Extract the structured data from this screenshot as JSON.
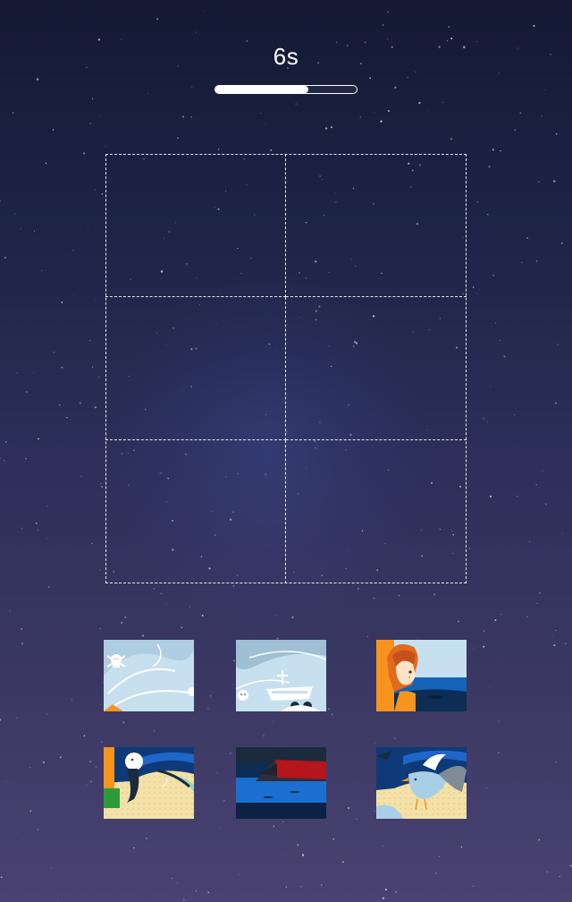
{
  "timer": {
    "label": "6s",
    "progress": 0.66
  },
  "board": {
    "rows": 3,
    "cols": 2,
    "filled_slots": 0
  },
  "pieces": [
    {
      "id": "p1",
      "icon": "skull-waves-piece"
    },
    {
      "id": "p2",
      "icon": "ship-wreck-skull-piece"
    },
    {
      "id": "p3",
      "icon": "girl-crying-piece"
    },
    {
      "id": "p4",
      "icon": "seal-beach-piece"
    },
    {
      "id": "p5",
      "icon": "sinking-ship-piece"
    },
    {
      "id": "p6",
      "icon": "seagull-beach-piece"
    }
  ],
  "colors": {
    "background_top": "#141a33",
    "background_bottom": "#4a4272",
    "accent": "#ffffff",
    "sea_blue": "#1a6fd0",
    "sky_light": "#c6e0ef",
    "orange": "#f7941d"
  }
}
